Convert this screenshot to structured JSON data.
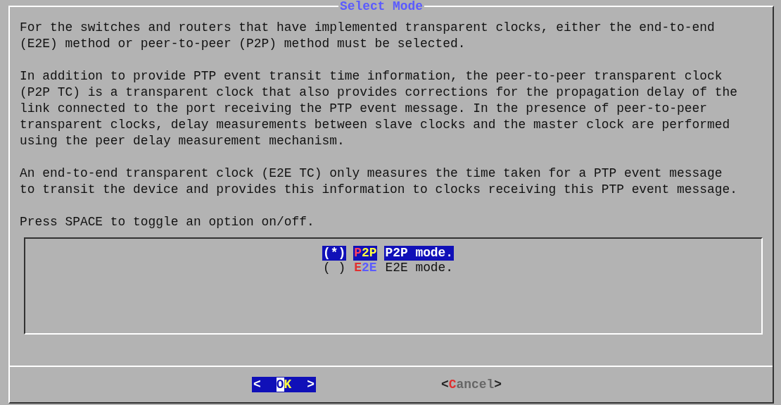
{
  "dialog": {
    "title": "Select Mode",
    "paragraphs": [
      "For the switches and routers that have implemented transparent clocks, either the end-to-end (E2E) method or peer-to-peer (P2P) method must be selected.",
      "In addition to provide PTP event transit time information, the peer-to-peer transparent clock (P2P TC) is a transparent clock that also provides corrections for the propagation delay of the link connected to the port receiving the PTP event message. In the presence of peer-to-peer transparent clocks, delay measurements between slave clocks and the master clock are performed using the peer delay measurement mechanism.",
      "An end-to-end transparent clock (E2E TC) only measures the time taken for a PTP event message to transit the device and provides this information to clocks receiving this PTP event message.",
      "Press SPACE to toggle an option on/off."
    ],
    "options": [
      {
        "mark": "(*)",
        "tag_hotkey": "P",
        "tag_rest": "2P",
        "description": "P2P mode.",
        "selected": true
      },
      {
        "mark": "( )",
        "tag_hotkey": "E",
        "tag_rest": "2E",
        "description": "E2E mode.",
        "selected": false
      }
    ],
    "buttons": [
      {
        "open": "<",
        "hotkey": "O",
        "rest": "K",
        "close": ">",
        "selected": true
      },
      {
        "open": "<",
        "hotkey": "C",
        "rest": "ancel",
        "close": ">",
        "selected": false
      }
    ]
  }
}
